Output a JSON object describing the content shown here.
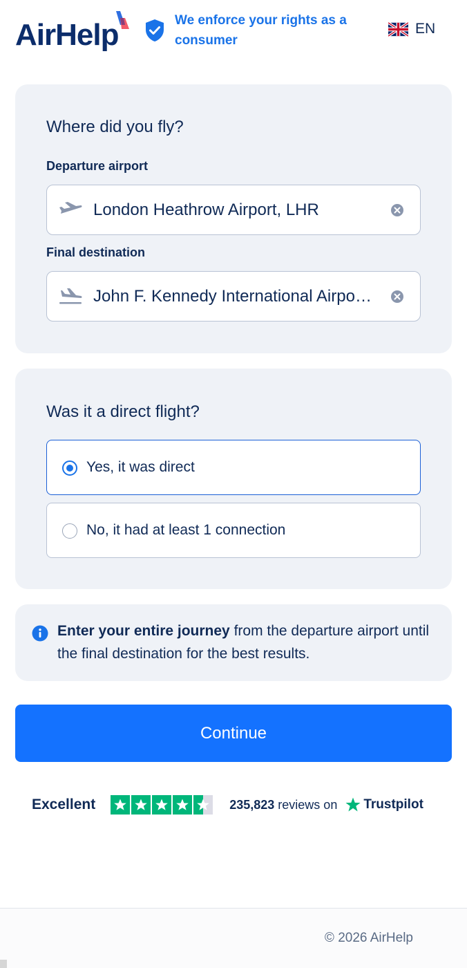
{
  "header": {
    "logo_text": "AirHelp",
    "tagline": "We enforce your rights as a consumer",
    "language": "EN",
    "brand_colors": {
      "navy": "#0c2d6b",
      "blue": "#1a73e8",
      "mark_red": "#f25a6a"
    }
  },
  "route_card": {
    "title": "Where did you fly?",
    "departure_label": "Departure airport",
    "departure_value": "London Heathrow Airport, LHR",
    "destination_label": "Final destination",
    "destination_value": "John F. Kennedy International Airport, JFK"
  },
  "direct_card": {
    "title": "Was it a direct flight?",
    "options": [
      {
        "label": "Yes, it was direct",
        "selected": true
      },
      {
        "label": "No, it had at least 1 connection",
        "selected": false
      }
    ]
  },
  "info": {
    "bold_text": "Enter your entire journey",
    "text": " from the departure airport until the final destination for the best results."
  },
  "continue_label": "Continue",
  "trustpilot": {
    "rating_word": "Excellent",
    "stars": 4.5,
    "review_count": "235,823",
    "reviews_on": "reviews on",
    "brand": "Trustpilot",
    "color": "#00b67a"
  },
  "footer": {
    "copyright": "© 2026 AirHelp"
  }
}
